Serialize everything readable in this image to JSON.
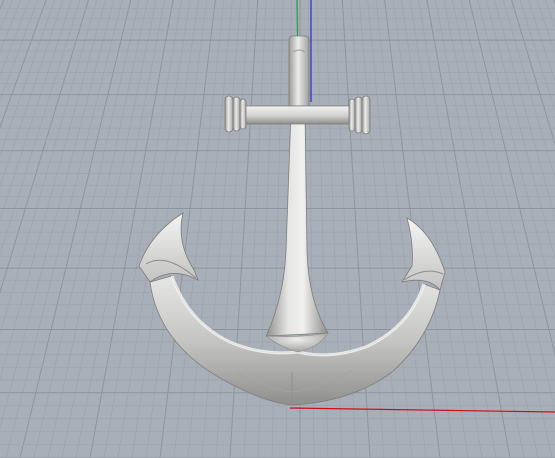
{
  "viewport": {
    "view": "perspective",
    "background": "#a9afb8",
    "grid": {
      "visible": true,
      "minor_color": "#9ca3ad",
      "major_color": "#8d949e"
    },
    "axes": {
      "x_color": "#c8101c",
      "y_color": "#22a049",
      "z_color": "#2430c8"
    },
    "model": {
      "name": "anchor",
      "material_color": "#c9c9c7",
      "icon": "anchor-icon"
    }
  }
}
